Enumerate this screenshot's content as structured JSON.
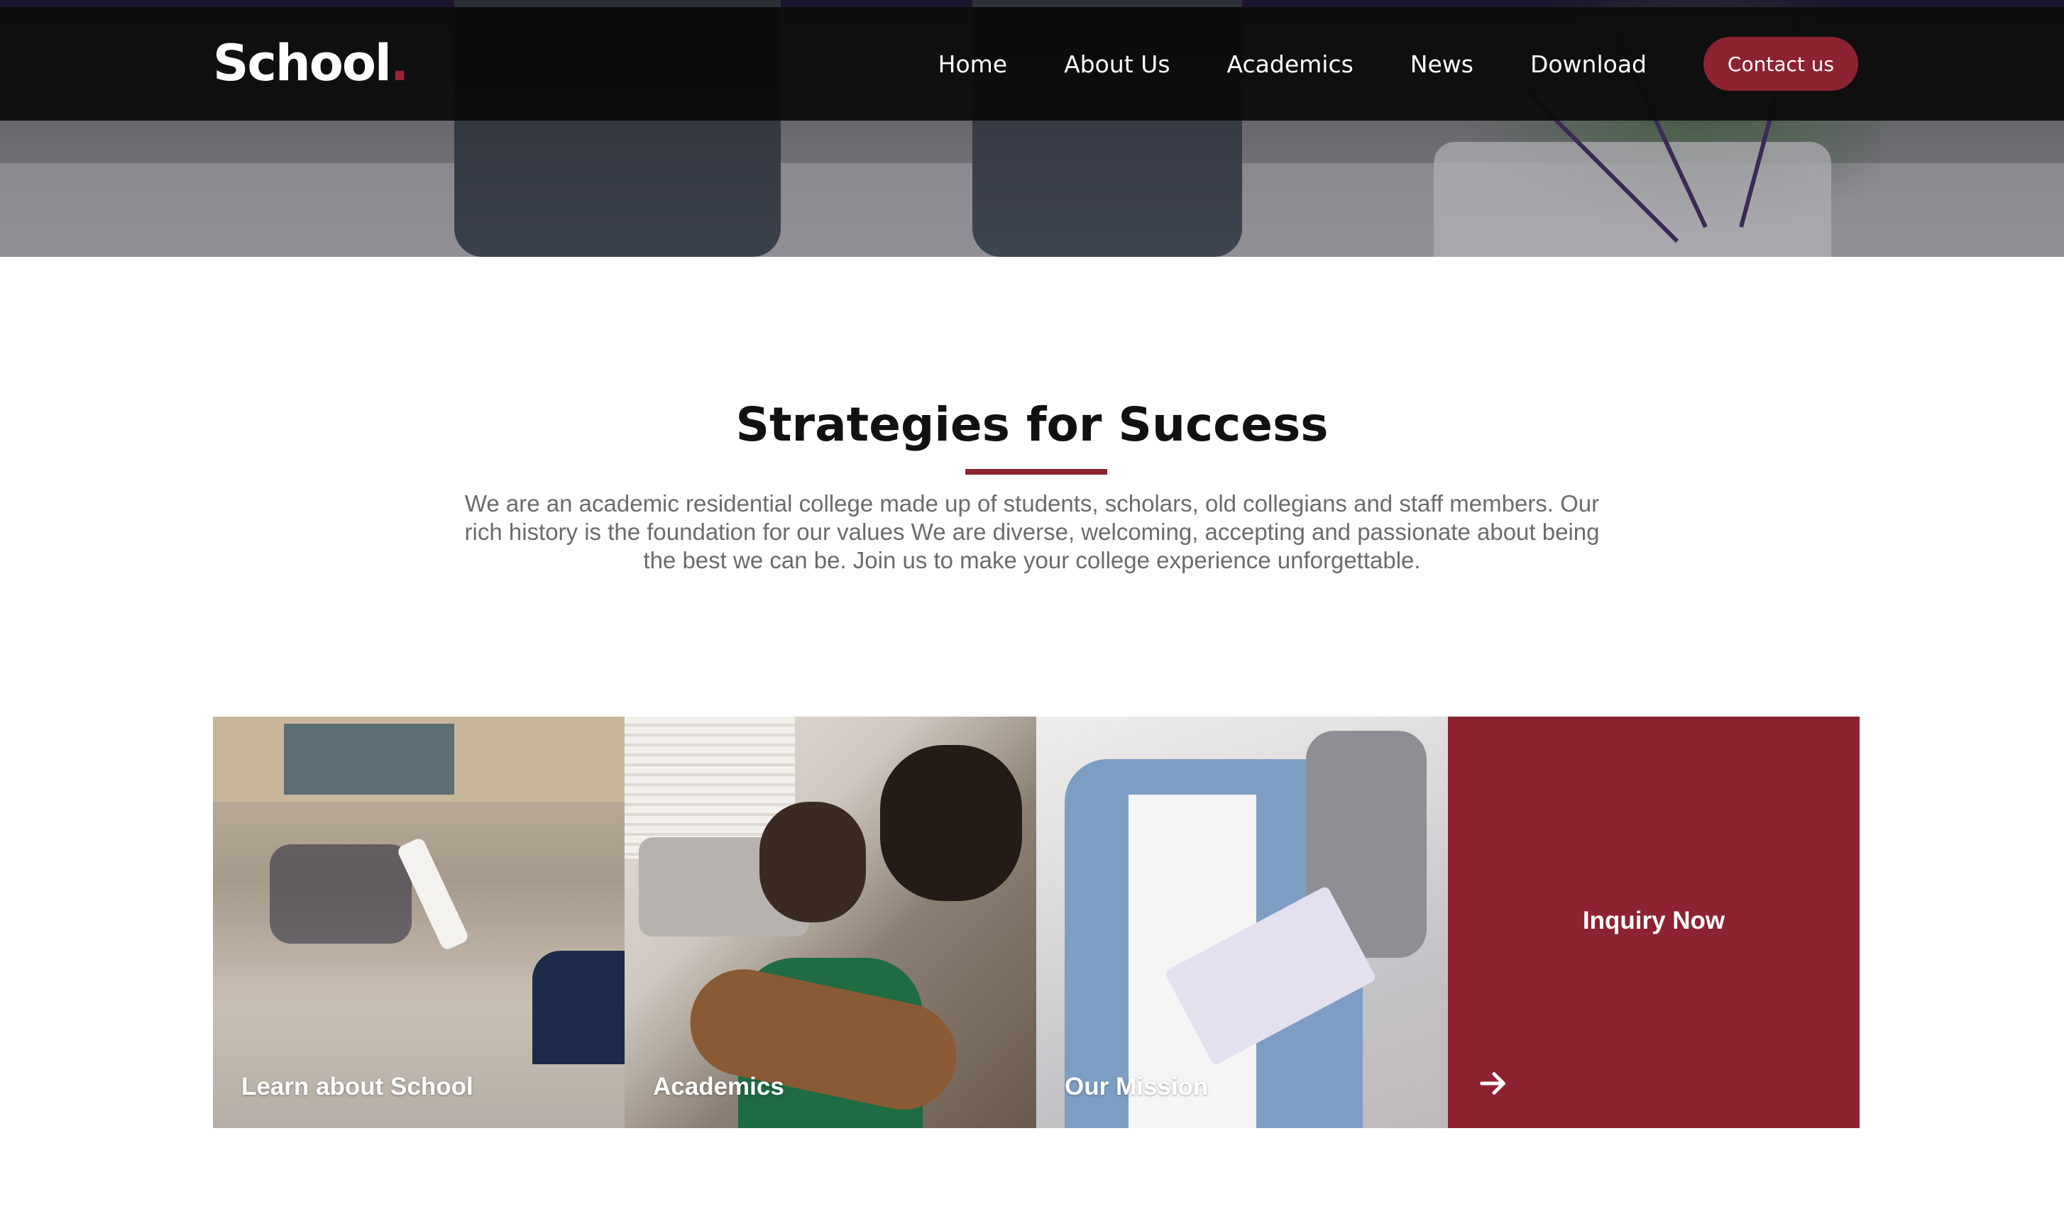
{
  "brand": {
    "name": "School",
    "dot": "."
  },
  "nav": {
    "items": [
      {
        "label": "Home"
      },
      {
        "label": "About Us"
      },
      {
        "label": "Academics"
      },
      {
        "label": "News"
      },
      {
        "label": "Download"
      }
    ],
    "contact_label": "Contact us"
  },
  "section": {
    "title": "Strategies for Success",
    "description": "We are an academic residential college made up of students, scholars, old collegians and staff members. Our rich history is the foundation for our values We are diverse, welcoming, accepting and passionate about being the best we can be. Join us to make your college experience unforgettable."
  },
  "cards": [
    {
      "label": "Learn about School"
    },
    {
      "label": "Academics"
    },
    {
      "label": "Our Mission"
    },
    {
      "label": "Inquiry Now",
      "icon": "arrow-right-icon"
    }
  ],
  "colors": {
    "accent": "#8d2230",
    "nav_bg": "#0a0a0a"
  }
}
